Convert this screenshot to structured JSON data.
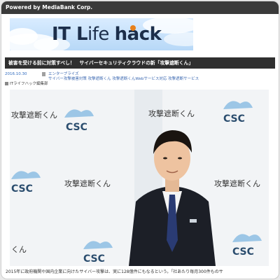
{
  "header": {
    "powered_by": "Powered by MediaBank Corp."
  },
  "logo": {
    "part1": "IT L",
    "part2": "ife ",
    "part3": "hack"
  },
  "article": {
    "headline": "被害を受ける前に対策すべし！　サイバーセキュリティクラウドの新「攻撃遮断くん」",
    "date": "2016.10.30",
    "category": "エンタープライズ",
    "tags": "サイバー攻撃被害対策  攻撃遮断くん  攻撃遮断くんWebサービス対応  攻撃遮断サービス",
    "byline": "ITライフハック編集部",
    "caption": "2015年に政府機関や国内企業に向けたサイバー攻撃は、実に128億件にもなるという。「社あたり毎月300件ものサ"
  },
  "photo": {
    "backdrop_brand": "CSC",
    "backdrop_brand_sub": "CYBER SECURITY CLOUD",
    "backdrop_product": "攻撃遮断くん"
  },
  "colors": {
    "topbar": "#3a3a3a",
    "headline_bar": "#2f2f2f",
    "link": "#3a67b0",
    "logo_accent": "#e7801a"
  }
}
